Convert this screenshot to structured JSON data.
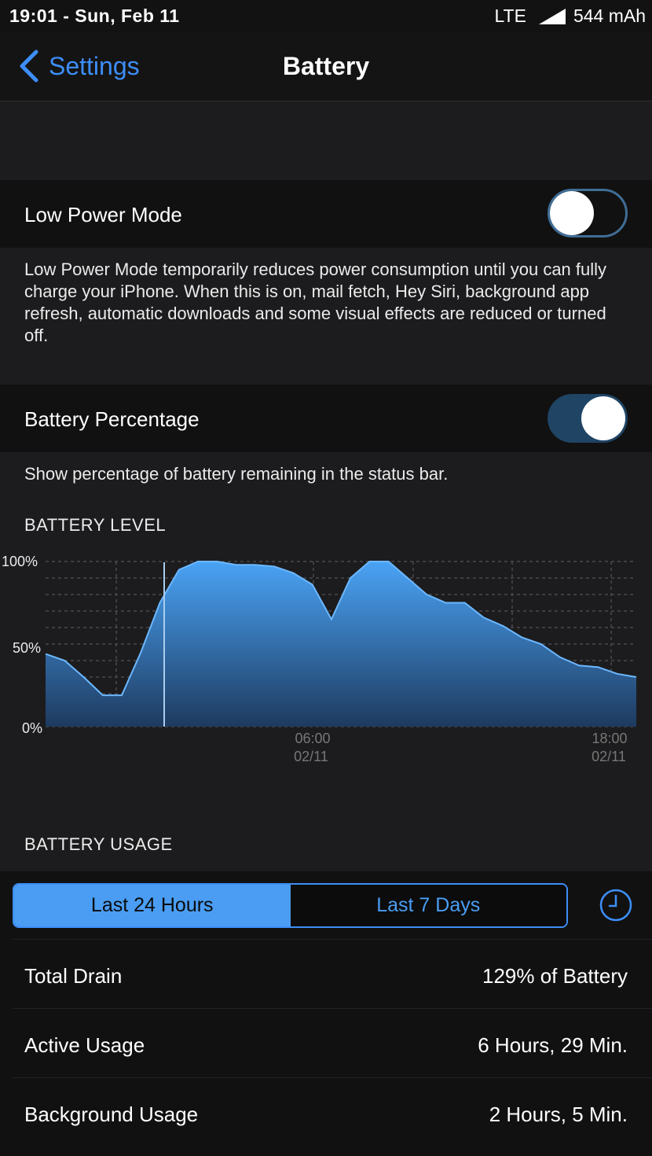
{
  "status_bar": {
    "time": "19:01 - Sun, Feb 11",
    "network": "LTE",
    "signal_icon": "cellular-signal-icon",
    "battery": "544 mAh"
  },
  "nav": {
    "back_label": "Settings",
    "title": "Battery"
  },
  "low_power": {
    "label": "Low Power Mode",
    "enabled": false,
    "footer": "Low Power Mode temporarily reduces power consumption until you can fully charge your iPhone. When this is on, mail fetch, Hey Siri, background app refresh, automatic downloads and some visual effects are reduced or turned off."
  },
  "battery_percentage": {
    "label": "Battery Percentage",
    "enabled": true,
    "footer": "Show percentage of battery remaining in the status bar."
  },
  "battery_level": {
    "header": "BATTERY LEVEL",
    "y_labels": [
      "100%",
      "50%",
      "0%"
    ],
    "x_labels": [
      {
        "time": "06:00",
        "date": "02/11"
      },
      {
        "time": "18:00",
        "date": "02/11"
      }
    ]
  },
  "battery_usage": {
    "header": "BATTERY USAGE",
    "segments": [
      "Last 24 Hours",
      "Last 7 Days"
    ],
    "selected_segment": "Last 24 Hours",
    "clock_icon": "clock-icon",
    "rows": [
      {
        "label": "Total Drain",
        "value": "129% of Battery"
      },
      {
        "label": "Active Usage",
        "value": "6 Hours, 29 Min."
      },
      {
        "label": "Background Usage",
        "value": "2 Hours, 5 Min."
      }
    ]
  },
  "colors": {
    "accent": "#3d8ef8",
    "chart_fill_top": "#4aa3f5",
    "chart_fill_bottom": "#1e3a5f",
    "background": "#1c1c1e",
    "cell": "#111111"
  },
  "chart_data": {
    "type": "area",
    "title": "BATTERY LEVEL",
    "xlabel": "",
    "ylabel": "",
    "ylim": [
      0,
      100
    ],
    "x_tick_labels": [
      "06:00 02/11",
      "18:00 02/11"
    ],
    "y_tick_labels": [
      "0%",
      "50%",
      "100%"
    ],
    "grid": true,
    "x": [
      "00:00",
      "00:30",
      "01:00",
      "01:30",
      "02:00",
      "02:30",
      "03:00",
      "03:30",
      "04:00",
      "05:00",
      "06:00",
      "06:30",
      "07:00",
      "07:30",
      "08:00",
      "08:30",
      "09:00",
      "09:30",
      "10:00",
      "10:30",
      "11:00",
      "12:00",
      "13:00",
      "13:30",
      "14:00",
      "14:30",
      "15:00",
      "16:00",
      "17:00",
      "17:30",
      "18:00",
      "18:15"
    ],
    "series": [
      {
        "values": [
          44,
          40,
          30,
          19,
          19,
          45,
          75,
          95,
          100,
          100,
          98,
          98,
          97,
          93,
          86,
          65,
          90,
          100,
          100,
          90,
          80,
          75,
          75,
          66,
          61,
          54,
          50,
          42,
          37,
          36,
          32,
          30
        ]
      }
    ]
  }
}
